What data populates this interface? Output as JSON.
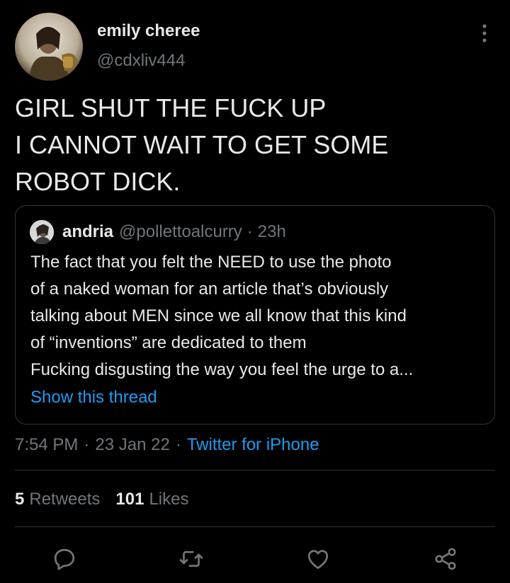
{
  "tweet": {
    "author": {
      "name": "emily cheree",
      "handle": "@cdxliv444"
    },
    "text_lines": [
      "GIRL SHUT THE FUCK UP",
      "I CANNOT WAIT TO GET SOME",
      "ROBOT DICK."
    ],
    "quoted_tweet": {
      "name": "andria",
      "handle": "@pollettoalcurry",
      "separator": "·",
      "time": "23h",
      "text_lines": [
        "The fact that you felt the NEED to use the photo",
        "of a naked woman for an article that’s obviously",
        "talking about MEN since we all know that this kind",
        "of “inventions” are dedicated to them",
        "Fucking disgusting the way you feel the urge to a..."
      ],
      "show_thread_label": "Show this thread"
    },
    "meta": {
      "time": "7:54 PM",
      "separator": "·",
      "date": "23 Jan 22",
      "source": "Twitter for iPhone"
    },
    "stats": {
      "retweets_count": "5",
      "retweets_label": "Retweets",
      "likes_count": "101",
      "likes_label": "Likes"
    },
    "actions": [
      "reply-icon",
      "retweet-icon",
      "like-icon",
      "share-icon"
    ]
  },
  "colors": {
    "background": "#000000",
    "text": "#e7e9ea",
    "secondary": "#71767b",
    "link": "#1d9bf0",
    "border": "#333639"
  }
}
